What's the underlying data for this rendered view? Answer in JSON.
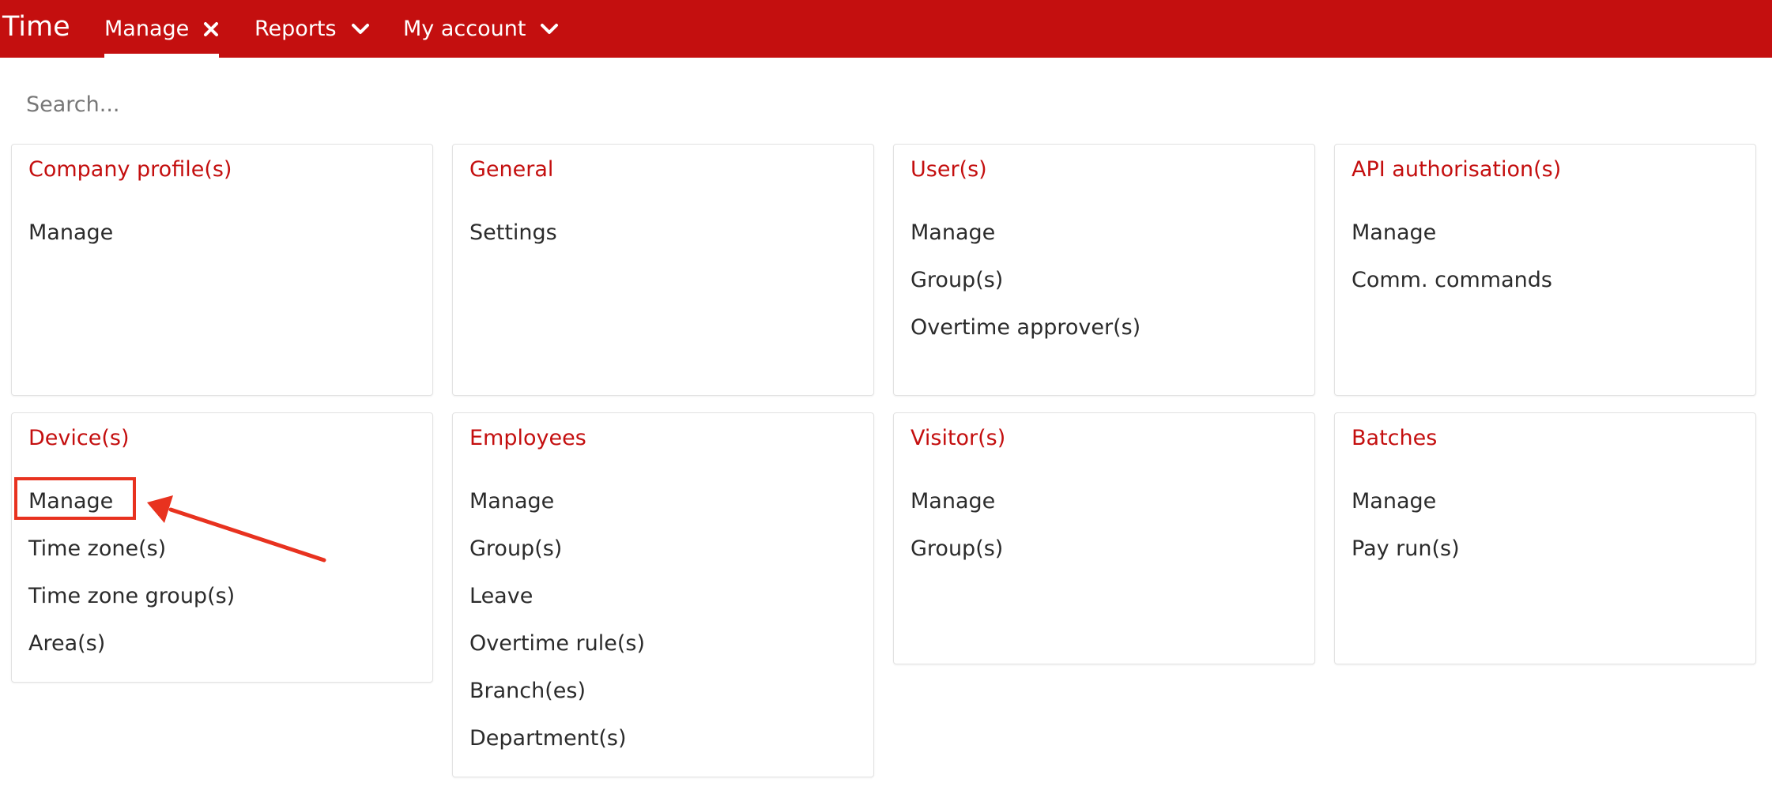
{
  "header": {
    "app_title": "Time",
    "nav": [
      {
        "label": "Manage",
        "icon": "close-icon",
        "active": true
      },
      {
        "label": "Reports",
        "icon": "chevron-down-icon",
        "active": false
      },
      {
        "label": "My account",
        "icon": "chevron-down-icon",
        "active": false
      }
    ]
  },
  "search": {
    "placeholder": "Search...",
    "value": ""
  },
  "cards": [
    {
      "title": "Company profile(s)",
      "links": [
        "Manage"
      ]
    },
    {
      "title": "General",
      "links": [
        "Settings"
      ]
    },
    {
      "title": "User(s)",
      "links": [
        "Manage",
        "Group(s)",
        "Overtime approver(s)"
      ]
    },
    {
      "title": "API authorisation(s)",
      "links": [
        "Manage",
        "Comm. commands"
      ]
    },
    {
      "title": "Device(s)",
      "links": [
        "Manage",
        "Time zone(s)",
        "Time zone group(s)",
        "Area(s)"
      ]
    },
    {
      "title": "Employees",
      "links": [
        "Manage",
        "Group(s)",
        "Leave",
        "Overtime rule(s)",
        "Branch(es)",
        "Department(s)"
      ]
    },
    {
      "title": "Visitor(s)",
      "links": [
        "Manage",
        "Group(s)"
      ]
    },
    {
      "title": "Batches",
      "links": [
        "Manage",
        "Pay run(s)"
      ]
    }
  ],
  "colors": {
    "brand_red": "#c40f0f",
    "annotation_red": "#e8321f",
    "text": "#2b2b2b"
  }
}
